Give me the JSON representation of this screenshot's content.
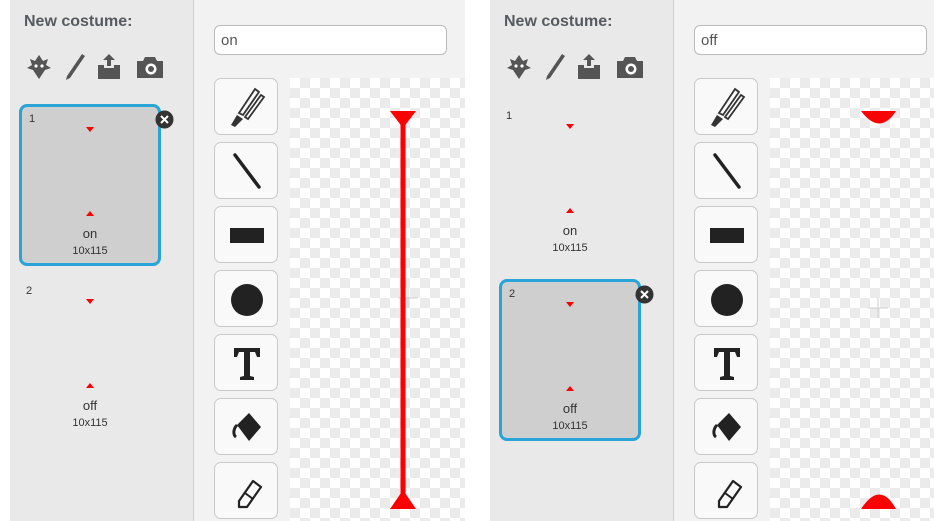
{
  "panels": [
    {
      "new_costume_label": "New costume:",
      "name_input_value": "on",
      "selected_costume": 1,
      "costumes": [
        {
          "number": "1",
          "name": "on",
          "size": "10x115"
        },
        {
          "number": "2",
          "name": "off",
          "size": "10x115"
        }
      ]
    },
    {
      "new_costume_label": "New costume:",
      "name_input_value": "off",
      "selected_costume": 2,
      "costumes": [
        {
          "number": "1",
          "name": "on",
          "size": "10x115"
        },
        {
          "number": "2",
          "name": "off",
          "size": "10x115"
        }
      ]
    }
  ],
  "new_costume_icons": [
    "choose-from-library-icon",
    "paint-new-icon",
    "upload-file-icon",
    "camera-icon"
  ],
  "tools": [
    "brush-icon",
    "line-icon",
    "rectangle-icon",
    "ellipse-icon",
    "text-icon",
    "fill-icon",
    "eraser-icon"
  ],
  "colors": {
    "selection_border": "#28a4d8",
    "costume_red": "#ff0000",
    "thumb_bg": "#cfcfcf"
  }
}
